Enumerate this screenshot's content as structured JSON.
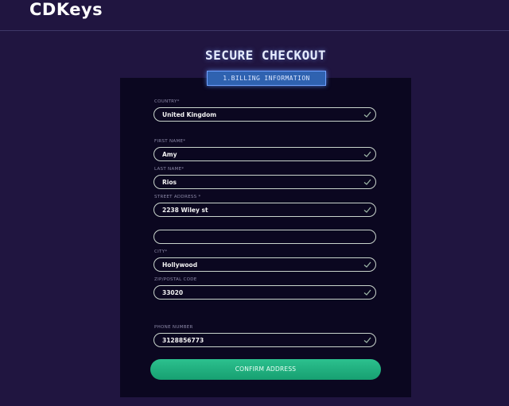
{
  "brand": {
    "logo": "CDKeys"
  },
  "page": {
    "title": "SECURE CHECKOUT",
    "step_label": "1.BILLING INFORMATION"
  },
  "form": {
    "country": {
      "label": "COUNTRY*",
      "value": "United Kingdom"
    },
    "first_name": {
      "label": "FIRST NAME*",
      "value": "Amy"
    },
    "last_name": {
      "label": "LAST NAME*",
      "value": "Rios"
    },
    "street": {
      "label": "STREET ADDRESS *",
      "value": "2238 Wiley st"
    },
    "street2": {
      "value": ""
    },
    "city": {
      "label": "CITY*",
      "value": "Hollywood"
    },
    "zip": {
      "label": "ZIP/POSTAL CODE",
      "value": "33020"
    },
    "phone": {
      "label": "PHONE NUMBER",
      "value": "3128856773"
    }
  },
  "actions": {
    "confirm_label": "CONFIRM ADDRESS"
  },
  "colors": {
    "background": "#201540",
    "panel": "#0b0720",
    "accent_green": "#1fae7f",
    "step_blue": "#2f62b0"
  }
}
